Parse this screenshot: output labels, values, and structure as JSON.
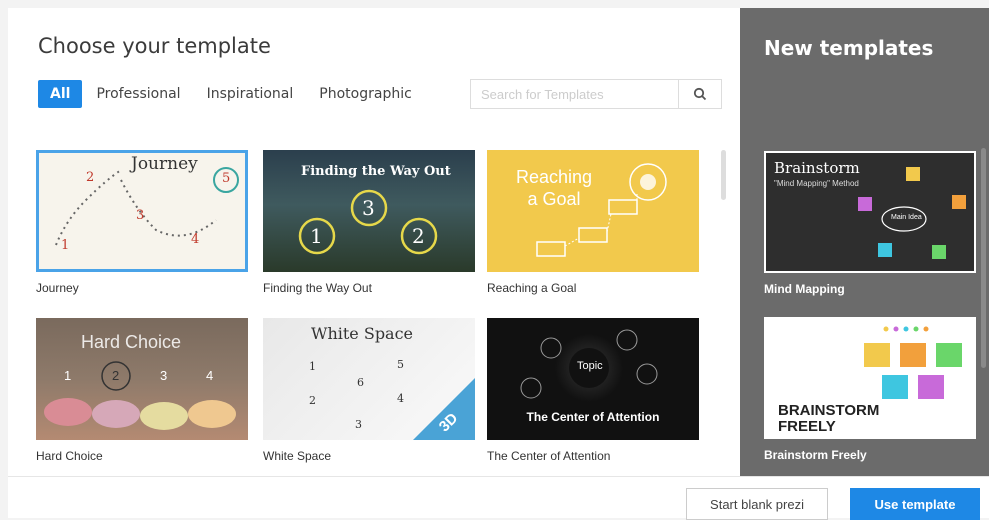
{
  "dialog": {
    "title": "Choose your template"
  },
  "tabs": [
    {
      "label": "All",
      "active": true
    },
    {
      "label": "Professional"
    },
    {
      "label": "Inspirational"
    },
    {
      "label": "Photographic"
    }
  ],
  "search": {
    "placeholder": "Search for Templates",
    "icon": "search-icon"
  },
  "templates": [
    {
      "label": "Journey",
      "thumb_title": "Journey",
      "numbers": [
        "1",
        "2",
        "3",
        "4",
        "5"
      ]
    },
    {
      "label": "Finding the Way Out",
      "thumb_title": "Finding the Way Out",
      "numbers": [
        "1",
        "2",
        "3"
      ]
    },
    {
      "label": "Reaching a Goal",
      "thumb_title": "Reaching a Goal"
    },
    {
      "label": "Hard Choice",
      "thumb_title": "Hard Choice",
      "numbers": [
        "1",
        "2",
        "3",
        "4"
      ]
    },
    {
      "label": "White Space",
      "thumb_title": "White Space",
      "badge": "3D",
      "numbers": [
        "1",
        "2",
        "3",
        "4",
        "5",
        "6"
      ]
    },
    {
      "label": "The Center of Attention",
      "thumb_title": "The Center of Attention",
      "center": "Topic"
    }
  ],
  "side": {
    "title": "New templates",
    "items": [
      {
        "label": "Mind Mapping",
        "thumb_title": "Brainstorm",
        "thumb_subtitle": "\"Mind Mapping\" Method",
        "thumb_bubble": "Main Idea"
      },
      {
        "label": "Brainstorm Freely",
        "thumb_title": "BRAINSTORM FREELY"
      }
    ]
  },
  "footer": {
    "blank_label": "Start blank prezi",
    "use_label": "Use template"
  },
  "colors": {
    "accent": "#1e88e5",
    "panel": "#6b6b6b"
  }
}
